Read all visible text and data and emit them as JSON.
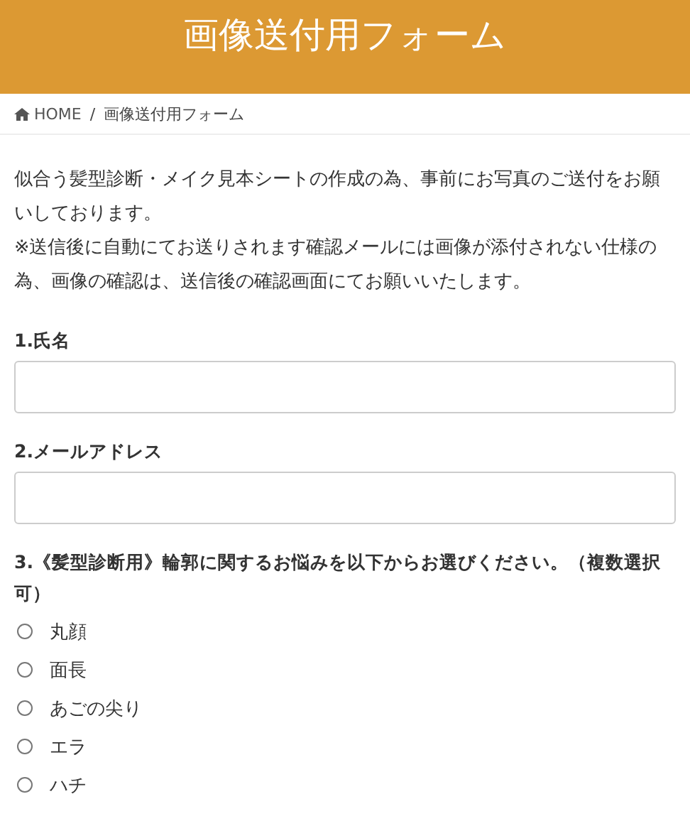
{
  "header": {
    "title": "画像送付用フォーム"
  },
  "breadcrumb": {
    "items": [
      {
        "label": "HOME",
        "kind": "home"
      },
      {
        "label": "画像送付用フォーム",
        "kind": "current"
      }
    ],
    "separator": "/"
  },
  "intro": [
    "似合う髪型診断・メイク見本シートの作成の為、事前にお写真のご送付をお願いしております。",
    "※送信後に自動にてお送りされます確認メールには画像が添付されない仕様の為、画像の確認は、送信後の確認画面にてお願いいたします。"
  ],
  "fields": [
    {
      "label": "1.氏名",
      "kind": "text"
    },
    {
      "label": "2.メールアドレス",
      "kind": "text"
    },
    {
      "label": "3.《髪型診断用》輪郭に関するお悩みを以下からお選びください。（複数選択可）",
      "kind": "choices",
      "options": [
        {
          "label": "丸顔",
          "selected": false
        },
        {
          "label": "面長",
          "selected": false
        },
        {
          "label": "あごの尖り",
          "selected": false
        },
        {
          "label": "エラ",
          "selected": false
        },
        {
          "label": "ハチ",
          "selected": false
        }
      ]
    }
  ]
}
